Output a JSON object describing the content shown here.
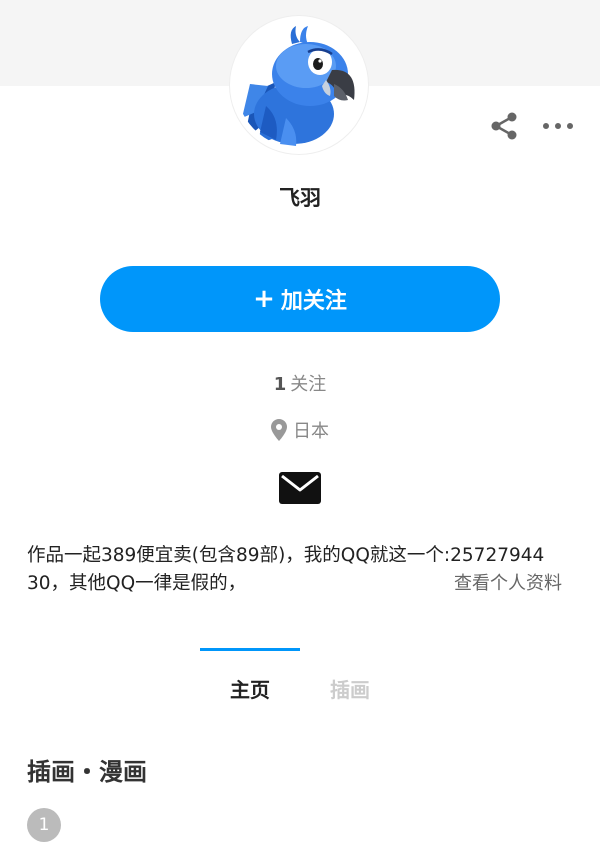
{
  "profile": {
    "username": "飞羽",
    "avatar_icon": "blue-parrot-avatar"
  },
  "toolbar": {
    "share_icon": "share-icon",
    "more_icon": "more-horizontal-icon"
  },
  "follow_button": {
    "plus": "+",
    "label": "加关注"
  },
  "stats": {
    "following_count": "1",
    "following_label": "关注"
  },
  "location": {
    "icon": "location-pin-icon",
    "text": "日本"
  },
  "message": {
    "icon": "mail-icon"
  },
  "bio": {
    "line1": "作品一起389便宜卖(包含89部)，我的QQ就这一个:25727944",
    "line2": "30，其他QQ一律是假的，",
    "view_profile": "查看个人资料"
  },
  "tabs": [
    {
      "label": "主页",
      "active": true
    },
    {
      "label": "插画",
      "active": false
    }
  ],
  "section": {
    "title": "插画・漫画",
    "count": "1"
  },
  "colors": {
    "accent": "#0096fa",
    "text_primary": "#222222",
    "text_secondary": "#888888",
    "inactive_tab": "#cccccc",
    "cover_bg": "#f5f5f5"
  }
}
